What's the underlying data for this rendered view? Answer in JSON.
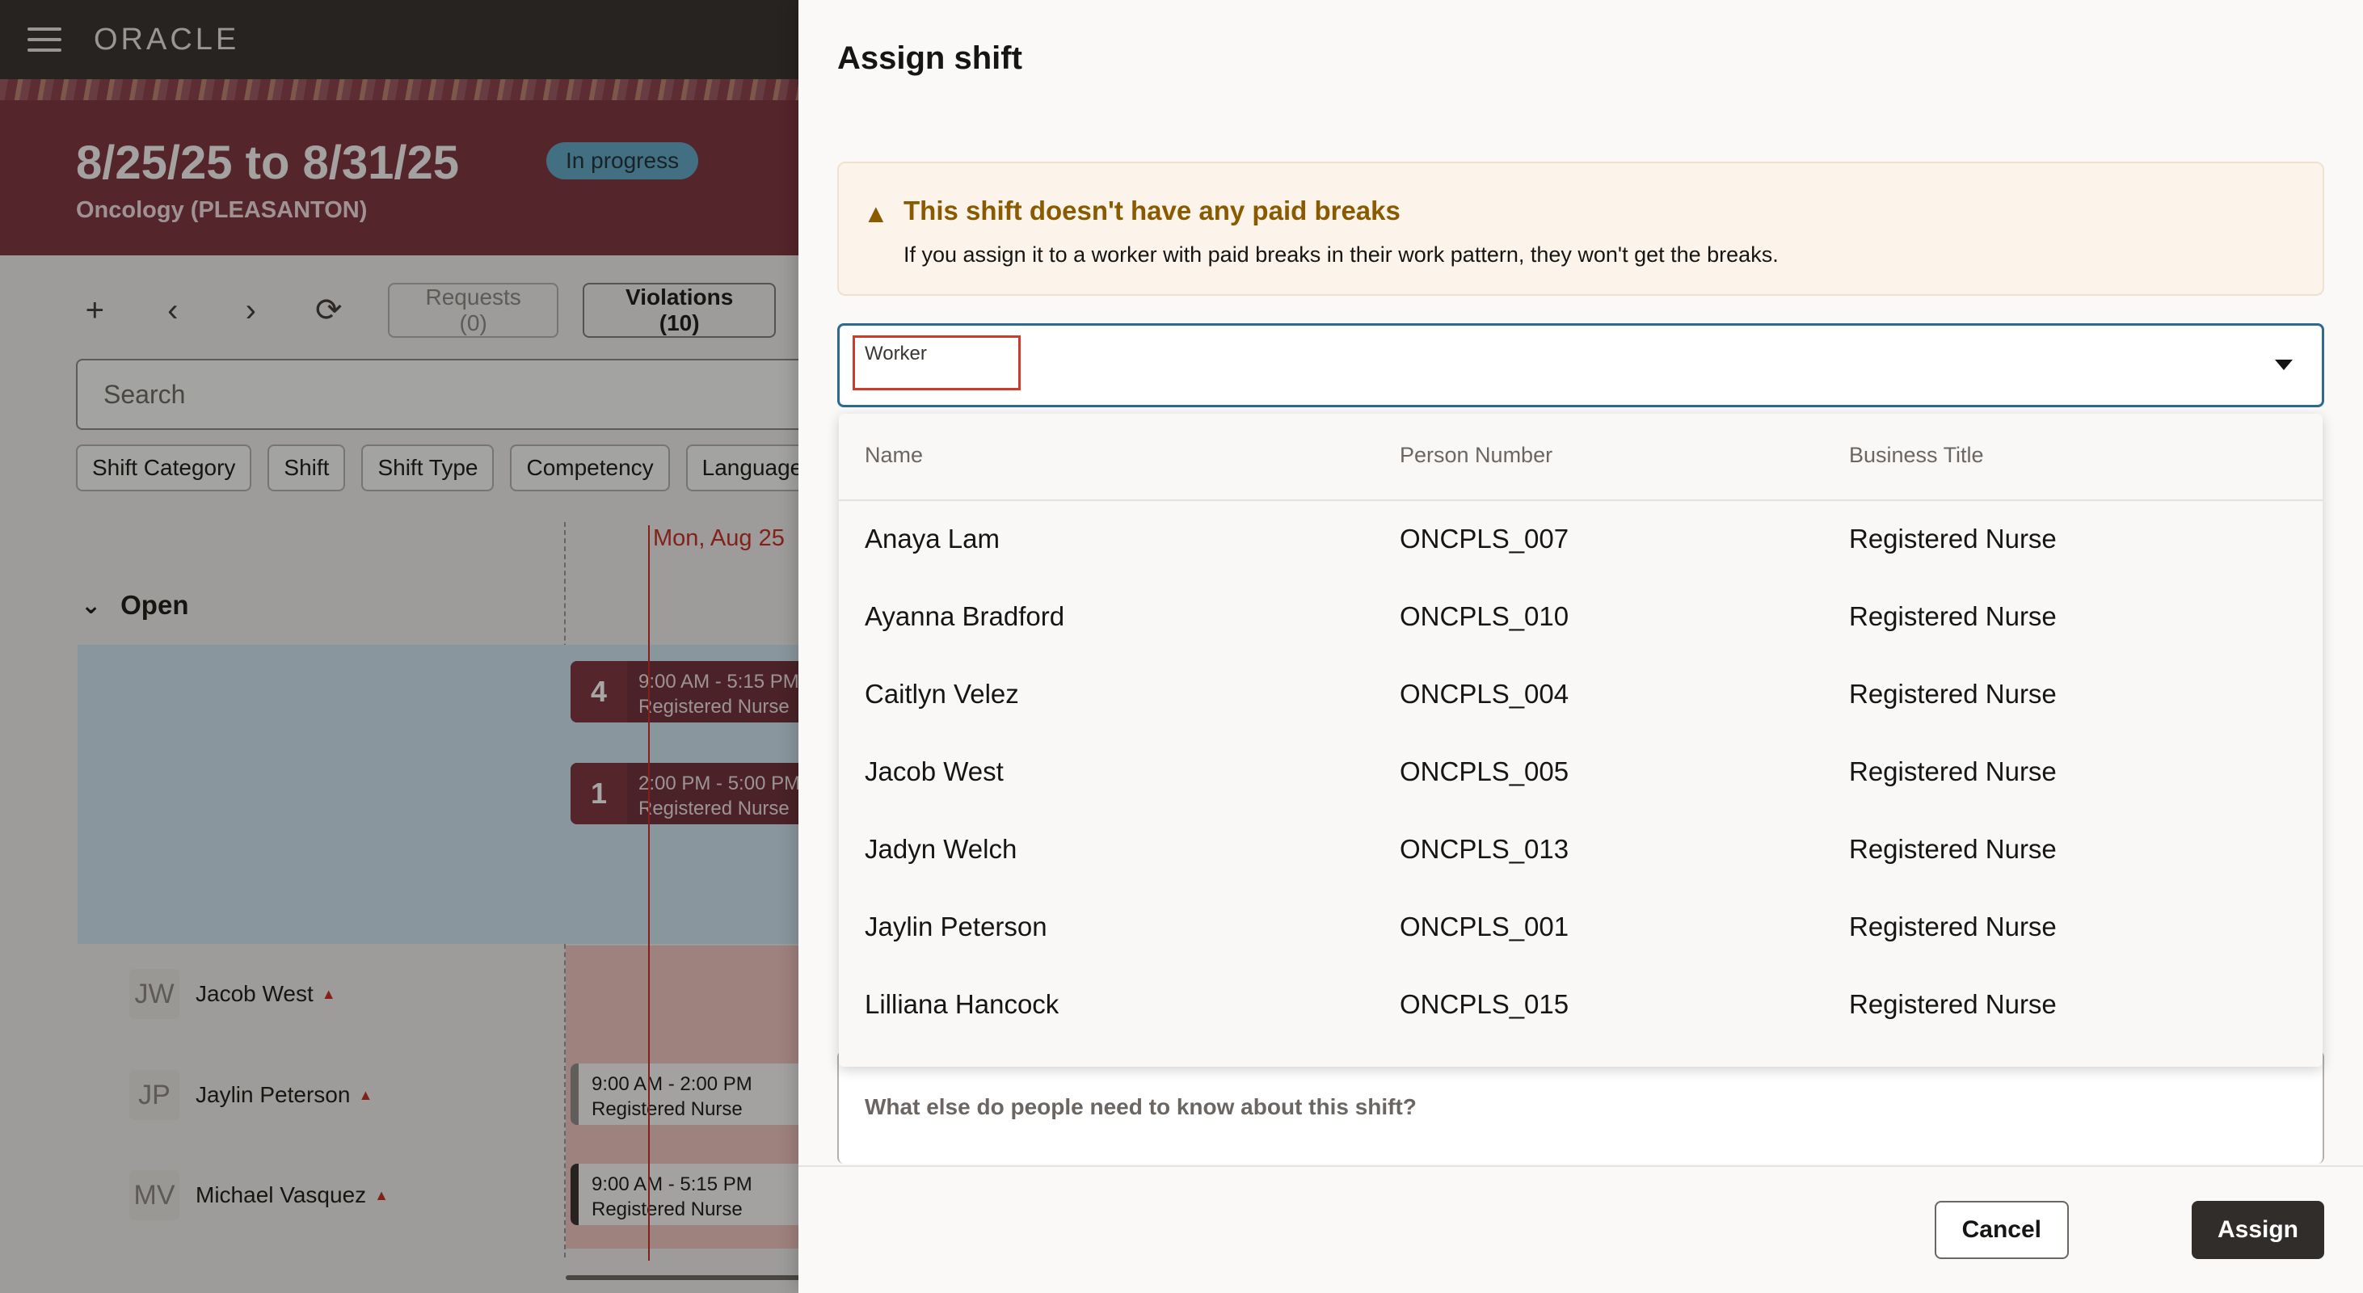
{
  "app": {
    "logo": "ORACLE"
  },
  "schedule": {
    "date_range": "8/25/25 to 8/31/25",
    "status": "In progress",
    "department": "Oncology (PLEASANTON)",
    "toolbar": {
      "requests_label": "Requests (0)",
      "violations_label": "Violations (10)"
    },
    "search_placeholder": "Search",
    "filters": [
      "Shift Category",
      "Shift",
      "Shift Type",
      "Competency",
      "Language"
    ],
    "day_header": "Mon, Aug 25",
    "open_section_label": "Open",
    "open_shifts": [
      {
        "count": "4",
        "time": "9:00 AM - 5:15 PM",
        "role": "Registered Nurse"
      },
      {
        "count": "1",
        "time": "2:00 PM - 5:00 PM",
        "role": "Registered Nurse"
      }
    ],
    "workers": [
      {
        "initials": "JW",
        "name": "Jacob West",
        "shift_time": "",
        "shift_role": ""
      },
      {
        "initials": "JP",
        "name": "Jaylin Peterson",
        "shift_time": "9:00 AM - 2:00 PM",
        "shift_role": "Registered Nurse"
      },
      {
        "initials": "MV",
        "name": "Michael Vasquez",
        "shift_time": "9:00 AM - 5:15 PM",
        "shift_role": "Registered Nurse"
      }
    ]
  },
  "drawer": {
    "title": "Assign shift",
    "alert": {
      "title": "This shift doesn't have any paid breaks",
      "text": "If you assign it to a worker with paid breaks in their work pattern, they won't get the breaks."
    },
    "worker_field": {
      "label": "Worker",
      "value": ""
    },
    "listbox": {
      "columns": [
        "Name",
        "Person Number",
        "Business Title"
      ],
      "rows": [
        {
          "name": "Anaya Lam",
          "number": "ONCPLS_007",
          "title": "Registered Nurse"
        },
        {
          "name": "Ayanna Bradford",
          "number": "ONCPLS_010",
          "title": "Registered Nurse"
        },
        {
          "name": "Caitlyn Velez",
          "number": "ONCPLS_004",
          "title": "Registered Nurse"
        },
        {
          "name": "Jacob West",
          "number": "ONCPLS_005",
          "title": "Registered Nurse"
        },
        {
          "name": "Jadyn Welch",
          "number": "ONCPLS_013",
          "title": "Registered Nurse"
        },
        {
          "name": "Jaylin Peterson",
          "number": "ONCPLS_001",
          "title": "Registered Nurse"
        },
        {
          "name": "Lilliana Hancock",
          "number": "ONCPLS_015",
          "title": "Registered Nurse"
        }
      ]
    },
    "notes_placeholder": "What else do people need to know about this shift?",
    "cancel_label": "Cancel",
    "assign_label": "Assign"
  }
}
